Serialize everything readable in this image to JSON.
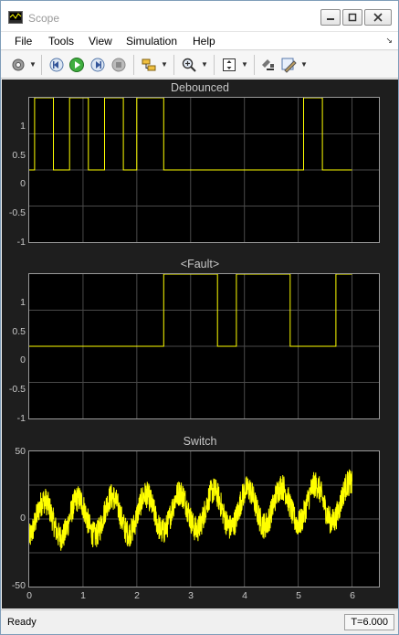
{
  "window": {
    "title": "Scope"
  },
  "menu": {
    "items": [
      "File",
      "Tools",
      "View",
      "Simulation",
      "Help"
    ]
  },
  "toolbar": {
    "icons": [
      "settings-gear-icon",
      "step-back-icon",
      "run-icon",
      "step-forward-icon",
      "stop-icon",
      "signal-selector-icon",
      "zoom-icon",
      "scale-axes-icon",
      "highlight-block-icon",
      "edit-style-icon"
    ]
  },
  "colors": {
    "signal": "#ffff00",
    "background": "#1e1e1e",
    "axes": "#000000",
    "grid": "#4a4a4a",
    "text": "#c8c8c8"
  },
  "chart_data": [
    {
      "type": "line",
      "title": "Debounced",
      "xlim": [
        0,
        6.5
      ],
      "ylim": [
        -1,
        1
      ],
      "yticks": [
        -1,
        -0.5,
        0,
        0.5,
        1
      ],
      "yticklabels": [
        "-1",
        "-0.5",
        "0",
        "0.5",
        "1"
      ],
      "series": [
        {
          "x": [
            0,
            0.1,
            0.1,
            0.45,
            0.45,
            0.75,
            0.75,
            1.1,
            1.1,
            1.4,
            1.4,
            1.75,
            1.75,
            2.0,
            2.0,
            2.5,
            2.5,
            5.1,
            5.1,
            5.45,
            5.45,
            6.0
          ],
          "y": [
            0,
            0,
            1,
            1,
            0,
            0,
            1,
            1,
            0,
            0,
            1,
            1,
            0,
            0,
            1,
            1,
            0,
            0,
            1,
            1,
            0,
            0
          ]
        }
      ]
    },
    {
      "type": "line",
      "title": "<Fault>",
      "xlim": [
        0,
        6.5
      ],
      "ylim": [
        -1,
        1
      ],
      "yticks": [
        -1,
        -0.5,
        0,
        0.5,
        1
      ],
      "yticklabels": [
        "-1",
        "-0.5",
        "0",
        "0.5",
        "1"
      ],
      "series": [
        {
          "x": [
            0,
            2.5,
            2.5,
            3.5,
            3.5,
            3.85,
            3.85,
            4.85,
            4.85,
            5.7,
            5.7,
            6.0
          ],
          "y": [
            0,
            0,
            1,
            1,
            0,
            0,
            1,
            1,
            0,
            0,
            1,
            1
          ]
        }
      ]
    },
    {
      "type": "line",
      "title": "Switch",
      "xlim": [
        0,
        6.5
      ],
      "ylim": [
        -50,
        50
      ],
      "yticks": [
        -50,
        0,
        50
      ],
      "yticklabels": [
        "-50",
        "0",
        "50"
      ],
      "xticks": [
        0,
        1,
        2,
        3,
        4,
        5,
        6
      ],
      "xticklabels": [
        "0",
        "1",
        "2",
        "3",
        "4",
        "5",
        "6"
      ],
      "series": [
        {
          "description_of_shape": "noisy sinusoid",
          "x_end": 6.0,
          "center_start": -1,
          "center_end": 13,
          "amplitude": 14,
          "period": 0.63,
          "noise_band": 20
        }
      ]
    }
  ],
  "status": {
    "state": "Ready",
    "time": "T=6.000"
  }
}
